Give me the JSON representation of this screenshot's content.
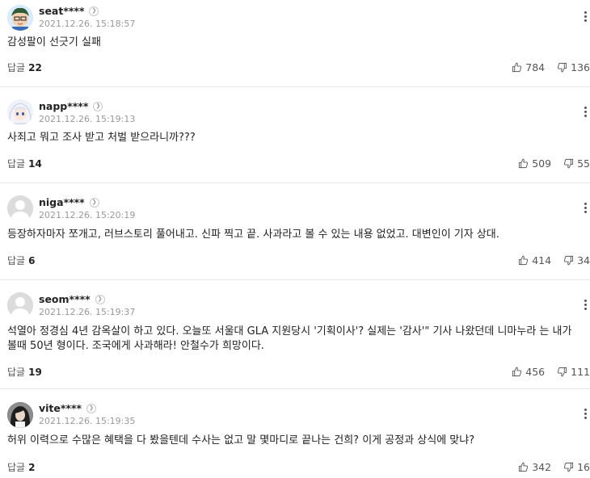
{
  "reply_label": "답글",
  "comments": [
    {
      "nickname": "seat****",
      "date": "2021.12.26. 15:18:57",
      "text": "감성팔이 선긋기 실패",
      "replies": "22",
      "likes": "784",
      "dislikes": "136",
      "avatar": "cartoon-avatar"
    },
    {
      "nickname": "napp****",
      "date": "2021.12.26. 15:19:13",
      "text": "사죄고 뭐고 조사 받고 처벌 받으라니까???",
      "replies": "14",
      "likes": "509",
      "dislikes": "55",
      "avatar": "anime-avatar"
    },
    {
      "nickname": "niga****",
      "date": "2021.12.26. 15:20:19",
      "text": "등장하자마자 쪼개고, 러브스토리 풀어내고. 신파 찍고 끝. 사과라고 볼 수 있는 내용 없었고. 대변인이 기자 상대.",
      "replies": "6",
      "likes": "414",
      "dislikes": "34",
      "avatar": "default-avatar"
    },
    {
      "nickname": "seom****",
      "date": "2021.12.26. 15:19:37",
      "text": "석열아 정경심 4년 감옥살이 하고 있다. 오늘또 서울대 GLA 지원당시 '기획이사'? 실제는 '감사'\" 기사 나왔던데 니마누라 는 내가 볼때 50년 형이다. 조국에게 사과해라! 안철수가 희망이다.",
      "replies": "19",
      "likes": "456",
      "dislikes": "111",
      "avatar": "default-avatar"
    },
    {
      "nickname": "vite****",
      "date": "2021.12.26. 15:19:35",
      "text": "허위 이력으로 수많은 혜택을 다 봤을텐데 수사는 없고 말 몇마디로 끝나는 건희? 이게 공정과 상식에 맞냐?",
      "replies": "2",
      "likes": "342",
      "dislikes": "16",
      "avatar": "photo-avatar"
    }
  ]
}
